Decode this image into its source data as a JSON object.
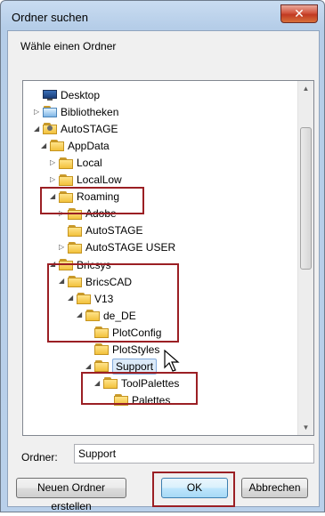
{
  "window": {
    "title": "Ordner suchen",
    "close_glyph": "✕"
  },
  "instruction": "Wähle einen Ordner",
  "tree": [
    {
      "label": "Desktop",
      "icon": "desktop-icon",
      "expander": ""
    },
    {
      "label": "Bibliotheken",
      "icon": "library-icon",
      "expander": "▷"
    },
    {
      "label": "AutoSTAGE",
      "icon": "user-icon",
      "expander": "◢"
    },
    {
      "label": "AppData",
      "icon": "folder-icon",
      "expander": "◢"
    },
    {
      "label": "Local",
      "icon": "folder-icon",
      "expander": "▷"
    },
    {
      "label": "LocalLow",
      "icon": "folder-icon",
      "expander": "▷"
    },
    {
      "label": "Roaming",
      "icon": "folder-icon",
      "expander": "◢"
    },
    {
      "label": "Adobe",
      "icon": "folder-icon",
      "expander": "▷"
    },
    {
      "label": "AutoSTAGE",
      "icon": "folder-icon",
      "expander": ""
    },
    {
      "label": "AutoSTAGE USER",
      "icon": "folder-icon",
      "expander": "▷"
    },
    {
      "label": "Bricsys",
      "icon": "folder-icon",
      "expander": "◢"
    },
    {
      "label": "BricsCAD",
      "icon": "folder-icon",
      "expander": "◢"
    },
    {
      "label": "V13",
      "icon": "folder-icon",
      "expander": "◢"
    },
    {
      "label": "de_DE",
      "icon": "folder-icon",
      "expander": "◢"
    },
    {
      "label": "PlotConfig",
      "icon": "folder-icon",
      "expander": ""
    },
    {
      "label": "PlotStyles",
      "icon": "folder-icon",
      "expander": ""
    },
    {
      "label": "Support",
      "icon": "folder-icon",
      "expander": "◢",
      "selected": true
    },
    {
      "label": "ToolPalettes",
      "icon": "folder-icon",
      "expander": "◢"
    },
    {
      "label": "Palettes",
      "icon": "folder-icon",
      "expander": ""
    }
  ],
  "scrollbar": {
    "up_glyph": "▲",
    "down_glyph": "▼"
  },
  "folder_field": {
    "label": "Ordner:",
    "value": "Support"
  },
  "buttons": {
    "new_folder": "Neuen Ordner erstellen",
    "ok": "OK",
    "cancel": "Abbrechen"
  },
  "colors": {
    "highlight_box": "#9b1f24",
    "selection": "#dbeaf8"
  }
}
